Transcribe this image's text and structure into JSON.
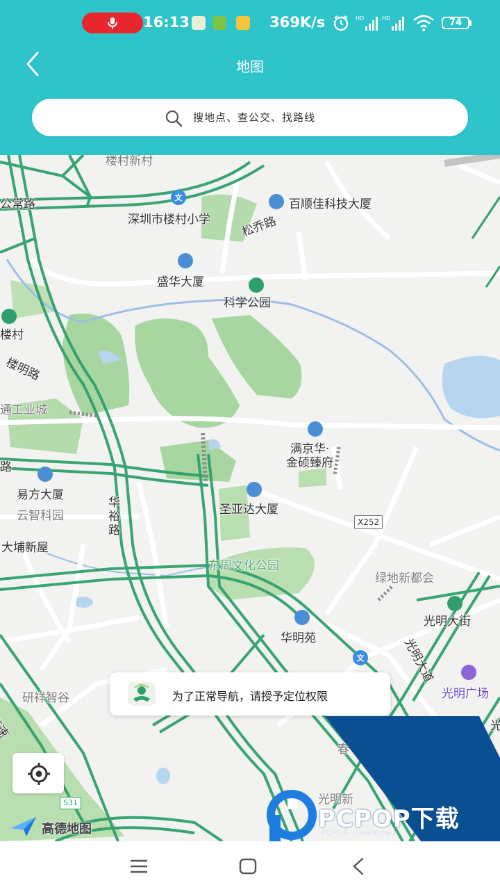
{
  "status_bar": {
    "time": "16:13",
    "network_speed": "369K/s",
    "battery": "74",
    "hd_label": "HD"
  },
  "header": {
    "title": "地图",
    "search_placeholder": "搜地点、查公交、找路线"
  },
  "map": {
    "labels": {
      "louchun_xincun": "楼村新村",
      "gongchang_lu": "公常路",
      "louchun_school": "深圳市楼村小学",
      "baishunjia": "百顺佳科技大厦",
      "songqiao_lu": "松乔路",
      "shenghua": "盛华大厦",
      "kexue_park": "科学公园",
      "loucun": "楼村",
      "louming_lu": "楼明路",
      "tong_industrial": "通工业城",
      "manjinghua": "满京华·",
      "jinshuo": "金硕臻府",
      "xx_lu": "路",
      "yifang": "易方大厦",
      "yunzhi_park": "云智科园",
      "shengyada": "圣亚达大厦",
      "huayu_lu": "华裕路",
      "x252": "X252",
      "dapu": "大埔新屋",
      "dongzhou_park": "东周文化公园",
      "lvdi": "绿地新都会",
      "guangming_street": "光明大街",
      "huamingyuan": "华明苑",
      "guangming_dadao": "光明大道",
      "guangming_plaza": "光明广场",
      "yanxiang": "研祥智谷",
      "gaosu": "高速",
      "s31": "S31",
      "guangming_xin": "光明新",
      "chun": "春",
      "wen": "文",
      "guang": "光",
      "gaode": "高德地图"
    },
    "toast": "为了正常导航，请授予定位权限"
  },
  "watermark": {
    "text": "PCPOP下载",
    "sub": "PCPOP Download"
  },
  "colors": {
    "header": "#2ec4ca",
    "road_main": "#2fa06b",
    "park": "#a7d6a0",
    "water": "#b5d6ee",
    "watermark": "#0b4f93"
  }
}
